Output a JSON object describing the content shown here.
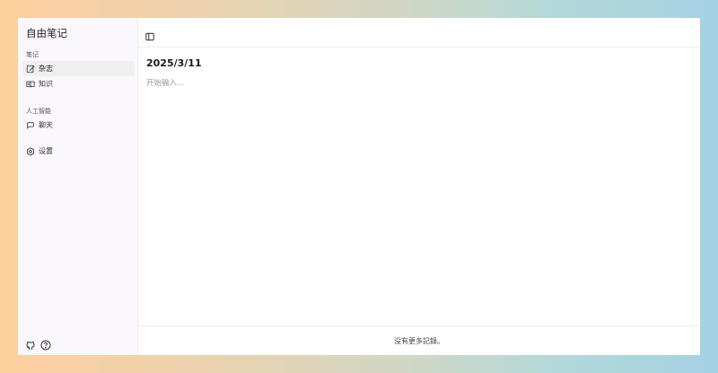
{
  "app": {
    "title": "自由笔记"
  },
  "sidebar": {
    "groups": [
      {
        "label": "笔记",
        "items": [
          {
            "label": "杂志",
            "icon": "edit-note-icon",
            "active": true
          },
          {
            "label": "知识",
            "icon": "book-icon",
            "active": false
          }
        ]
      },
      {
        "label": "人工智能",
        "items": [
          {
            "label": "聊天",
            "icon": "chat-icon",
            "active": false
          }
        ]
      }
    ],
    "settings": {
      "label": "设置",
      "icon": "gear-icon"
    },
    "bottom_icons": [
      "github-icon",
      "help-icon"
    ]
  },
  "main": {
    "toolbar": {
      "toggle_icon": "sidebar-toggle-icon"
    },
    "note": {
      "date": "2025/3/11",
      "placeholder": "开始输入..."
    },
    "footer": {
      "text": "没有更多記錄。"
    }
  },
  "colors": {
    "sidebar_bg": "#fbf8fd",
    "active_item_bg": "#f0eff0",
    "placeholder": "#9a9a9a"
  }
}
